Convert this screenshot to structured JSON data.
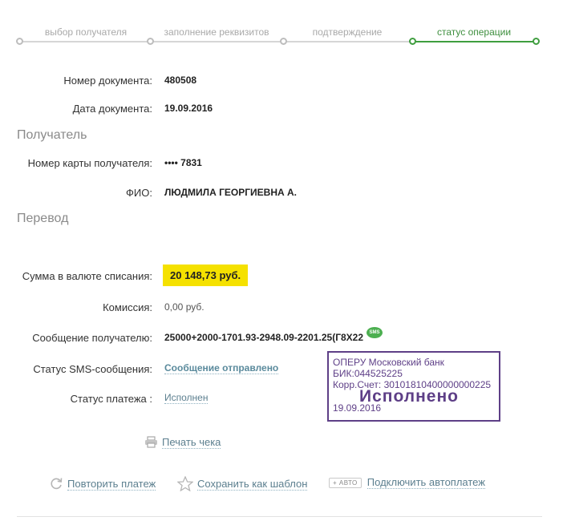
{
  "stepper": {
    "steps": [
      "выбор получателя",
      "заполнение реквизитов",
      "подтверждение",
      "статус операции"
    ]
  },
  "document": {
    "number_label": "Номер документа:",
    "number_value": "480508",
    "date_label": "Дата документа:",
    "date_value": "19.09.2016"
  },
  "recipient": {
    "section_title": "Получатель",
    "card_label": "Номер карты получателя:",
    "card_value": "•••• 7831",
    "name_label": "ФИО:",
    "name_value": "ЛЮДМИЛА ГЕОРГИЕВНА А."
  },
  "transfer": {
    "section_title": "Перевод",
    "amount_label": "Сумма в валюте списания:",
    "amount_value": "20 148,73  руб.",
    "commission_label": "Комиссия:",
    "commission_value": "0,00 руб.",
    "message_label": "Сообщение получателю:",
    "message_value": "25000+2000-1701.93-2948.09-2201.25(Г8Х22",
    "sms_badge": "SMS",
    "sms_status_label": "Статус SMS-сообщения:",
    "sms_status_value": "Сообщение отправлено",
    "payment_status_label": "Статус платежа :",
    "payment_status_value": "Исполнен"
  },
  "stamp": {
    "line1": "ОПЕРУ Московский банк",
    "line2": "БИК:044525225",
    "line3": "Корр.Счет: 30101810400000000225",
    "status": "Исполнено",
    "date": "19.09.2016"
  },
  "actions": {
    "print": "Печать чека",
    "repeat": "Повторить платеж",
    "save_template": "Сохранить как шаблон",
    "avto_badge": "+ АВТО",
    "autopay": "Подключить автоплатеж"
  },
  "colors": {
    "accent_green": "#3f9e3f",
    "highlight_yellow": "#f5e100",
    "stamp_purple": "#5e3f87",
    "link": "#5c7f8f"
  }
}
